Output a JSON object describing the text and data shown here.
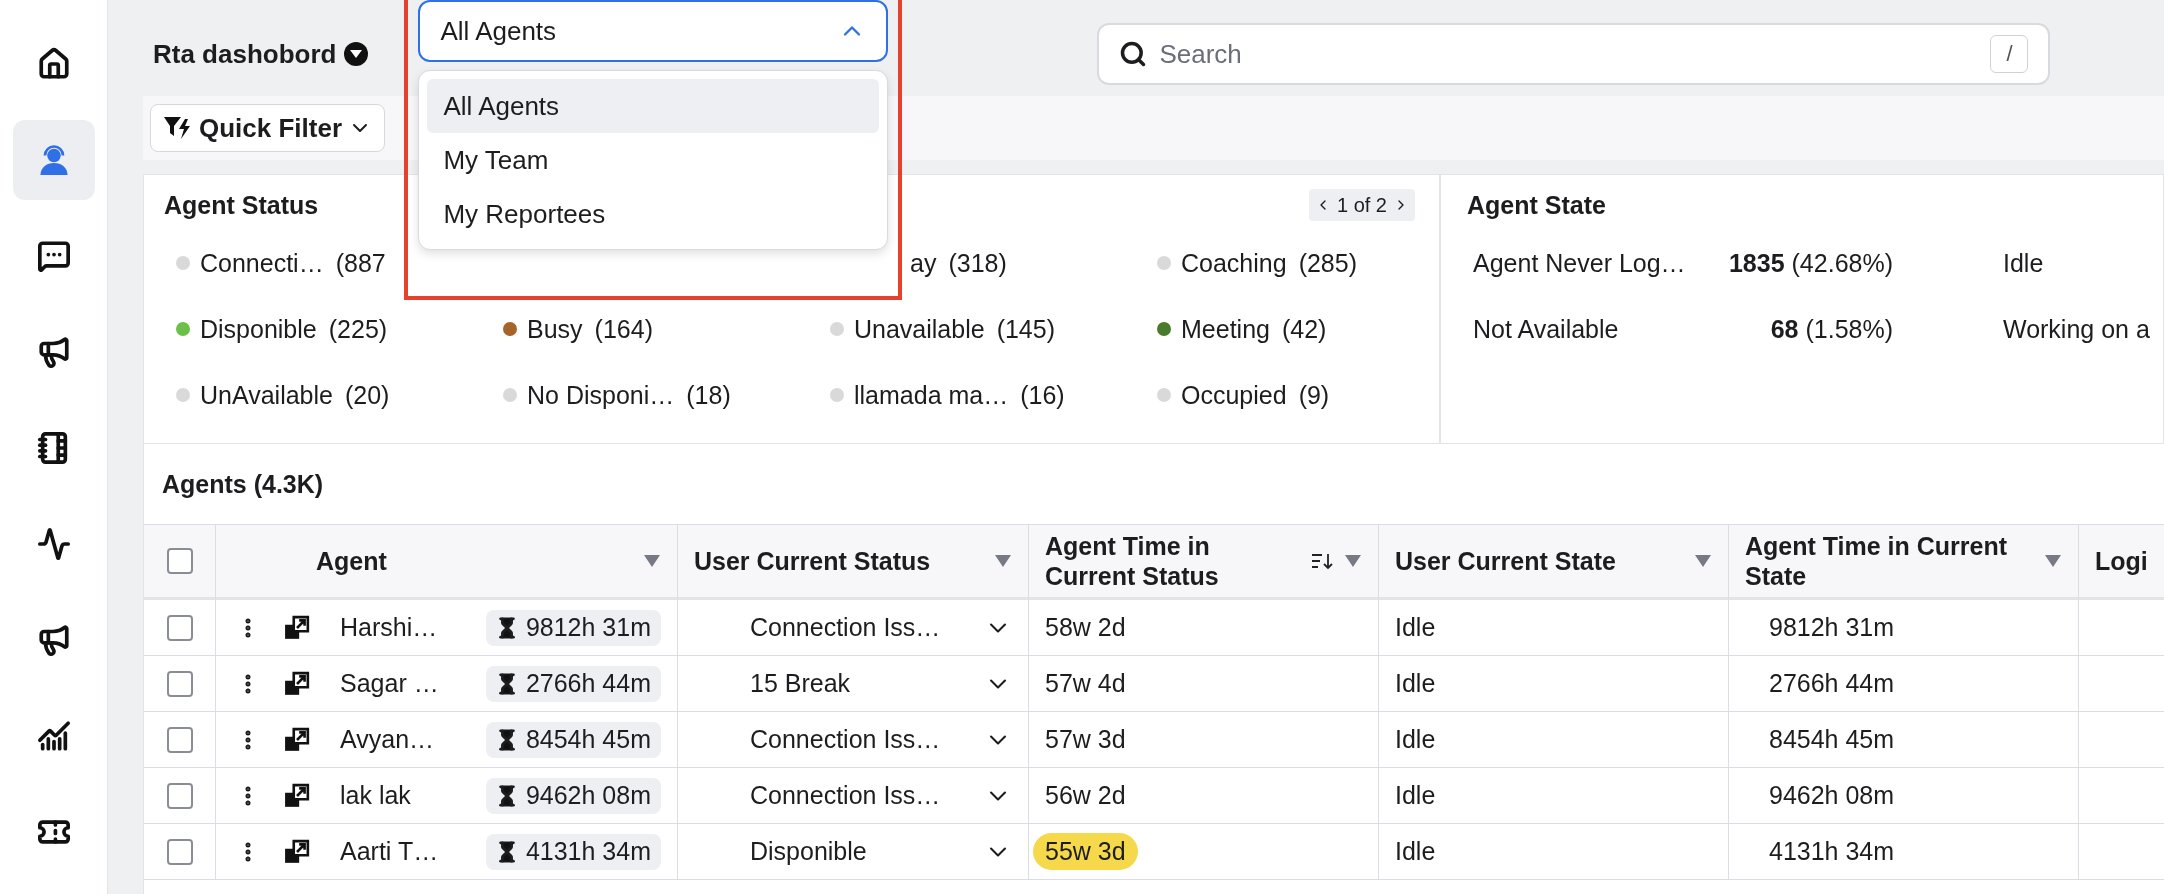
{
  "sidebar": {
    "items": [
      {
        "kind": "home",
        "selected": false
      },
      {
        "kind": "agent",
        "selected": true
      },
      {
        "kind": "chat",
        "selected": false
      },
      {
        "kind": "megaphone",
        "selected": false
      },
      {
        "kind": "notebook",
        "selected": false
      },
      {
        "kind": "activity",
        "selected": false
      },
      {
        "kind": "broadcast",
        "selected": false
      },
      {
        "kind": "chart",
        "selected": false
      },
      {
        "kind": "ticket",
        "selected": false
      }
    ]
  },
  "header": {
    "title": "Rta dashobord",
    "view_select": {
      "value": "All Agents",
      "expanded": true,
      "options": [
        {
          "label": "All Agents",
          "selected": true
        },
        {
          "label": "My Team",
          "selected": false
        },
        {
          "label": "My Reportees",
          "selected": false
        }
      ]
    },
    "search": {
      "placeholder": "Search",
      "shortcut": "/"
    }
  },
  "toolbar": {
    "quick_filter": "Quick Filter"
  },
  "agent_status": {
    "title": "Agent Status",
    "pager": "1 of 2",
    "items": [
      {
        "kind": "dot",
        "label": "Connecti…",
        "count": "(887",
        "color": "#d9d9d9"
      },
      {
        "kind": "hidden"
      },
      {
        "kind": "cut",
        "label": "ay",
        "count": "(318)"
      },
      {
        "kind": "dot",
        "label": "Coaching",
        "count": "(285)",
        "color": "#d9d9d9"
      },
      {
        "kind": "dot",
        "label": "Disponible",
        "count": "(225)",
        "color": "#6cc04a"
      },
      {
        "kind": "dot",
        "label": "Busy",
        "count": "(164)",
        "color": "#a5642a"
      },
      {
        "kind": "dot",
        "label": "Unavailable",
        "count": "(145)",
        "color": "#d9d9d9"
      },
      {
        "kind": "dot",
        "label": "Meeting",
        "count": "(42)",
        "color": "#4a7a2c"
      },
      {
        "kind": "dot",
        "label": "UnAvailable",
        "count": "(20)",
        "color": "#d9d9d9"
      },
      {
        "kind": "dot",
        "label": "No Disponi…",
        "count": "(18)",
        "color": "#d9d9d9"
      },
      {
        "kind": "dot",
        "label": "llamada ma…",
        "count": "(16)",
        "color": "#d9d9d9"
      },
      {
        "kind": "dot",
        "label": "Occupied",
        "count": "(9)",
        "color": "#d9d9d9"
      }
    ]
  },
  "agent_state": {
    "title": "Agent State",
    "rows": [
      {
        "label": "Agent Never Log…",
        "count": "1835",
        "percent": "(42.68%)",
        "next_label": "Idle"
      },
      {
        "label": "Not Available",
        "count": "68",
        "percent": "(1.58%)",
        "next_label": "Working on a"
      }
    ]
  },
  "agents": {
    "title": "Agents (4.3K)",
    "all_checked": false,
    "columns": [
      {
        "label": "Agent",
        "sortable": false
      },
      {
        "label": "User Current Status",
        "sortable": false
      },
      {
        "label": "Agent Time in Current Status",
        "sortable": true
      },
      {
        "label": "User Current State",
        "sortable": false
      },
      {
        "label": "Agent Time in Current State",
        "sortable": false
      },
      {
        "label": "Logi",
        "sortable": false
      }
    ],
    "rows": [
      {
        "checked": false,
        "name": "Harshi…",
        "timer": "9812h 31m",
        "status": "Connection Iss…",
        "time_in_status": "58w 2d",
        "highlighted": false,
        "state": "Idle",
        "time_in_state": "9812h 31m"
      },
      {
        "checked": false,
        "name": "Sagar …",
        "timer": "2766h 44m",
        "status": "15 Break",
        "time_in_status": "57w 4d",
        "highlighted": false,
        "state": "Idle",
        "time_in_state": "2766h 44m"
      },
      {
        "checked": false,
        "name": "Avyan…",
        "timer": "8454h 45m",
        "status": "Connection Iss…",
        "time_in_status": "57w 3d",
        "highlighted": false,
        "state": "Idle",
        "time_in_state": "8454h 45m"
      },
      {
        "checked": false,
        "name": "lak lak",
        "timer": "9462h 08m",
        "status": "Connection Iss…",
        "time_in_status": "56w 2d",
        "highlighted": false,
        "state": "Idle",
        "time_in_state": "9462h 08m"
      },
      {
        "checked": false,
        "name": "Aarti T…",
        "timer": "4131h 34m",
        "status": "Disponible",
        "time_in_status": "55w 3d",
        "highlighted": true,
        "state": "Idle",
        "time_in_state": "4131h 34m"
      }
    ]
  }
}
